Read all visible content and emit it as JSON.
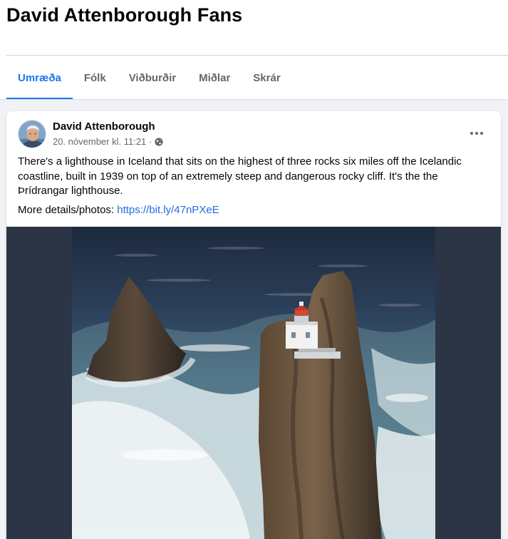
{
  "group": {
    "title": "David Attenborough Fans"
  },
  "tabs": [
    {
      "label": "Umræða",
      "active": true
    },
    {
      "label": "Fólk",
      "active": false
    },
    {
      "label": "Viðburðir",
      "active": false
    },
    {
      "label": "Miðlar",
      "active": false
    },
    {
      "label": "Skrár",
      "active": false
    }
  ],
  "post": {
    "author": "David Attenborough",
    "timestamp": "20. nóvember kl. 11:21 ·",
    "privacy_icon": "globe-icon",
    "more_icon": "ellipsis-icon",
    "text": "There's a lighthouse in Iceland that sits on the highest of three rocks six miles off the Icelandic coastline, built in 1939 on top of an extremely steep and dangerous rocky cliff. It's the the Þrídrangar lighthouse.",
    "link_prefix": "More details/photos: ",
    "link_text": "https://bit.ly/47nPXeE",
    "image": "lighthouse-on-sea-stack-photo"
  },
  "colors": {
    "accent": "#1877f2",
    "link": "#216fdb",
    "muted_text": "#65676b",
    "media_background": "#2c3545"
  }
}
